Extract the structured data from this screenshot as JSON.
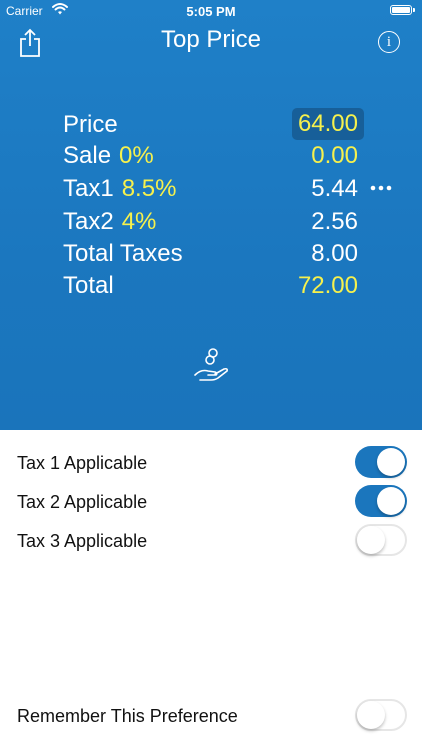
{
  "status_bar": {
    "carrier": "Carrier",
    "time": "5:05 PM"
  },
  "nav": {
    "title": "Top Price"
  },
  "calculator": {
    "price": {
      "label": "Price",
      "value": "64.00"
    },
    "sale": {
      "label": "Sale",
      "percent": "0%",
      "value": "0.00"
    },
    "tax1": {
      "label": "Tax1",
      "percent": "8.5%",
      "value": "5.44"
    },
    "tax2": {
      "label": "Tax2",
      "percent": "4%",
      "value": "2.56"
    },
    "total_taxes": {
      "label": "Total Taxes",
      "value": "8.00"
    },
    "total": {
      "label": "Total",
      "value": "72.00"
    }
  },
  "settings": {
    "tax1": {
      "label": "Tax 1 Applicable",
      "on": true
    },
    "tax2": {
      "label": "Tax 2 Applicable",
      "on": true
    },
    "tax3": {
      "label": "Tax 3 Applicable",
      "on": false
    },
    "remember": {
      "label": "Remember This Preference",
      "on": false
    }
  },
  "colors": {
    "header_blue": "#1b77bf",
    "highlight_yellow": "#f6f14d",
    "toggle_on": "#1b76bd"
  },
  "icons": [
    "wifi-icon",
    "battery-icon",
    "share-icon",
    "info-icon",
    "more-icon",
    "hand-coins-icon"
  ]
}
